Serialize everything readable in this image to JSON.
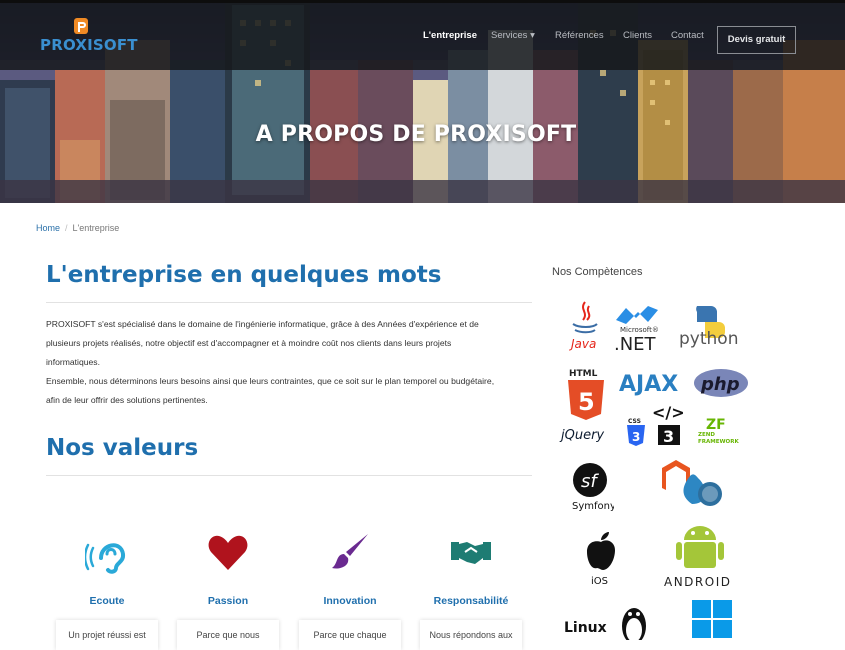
{
  "brand": {
    "name": "PROXISOFT"
  },
  "nav": {
    "items": [
      "L'entreprise",
      "Services ▾",
      "Références",
      "Clients",
      "Contact"
    ],
    "cta": "Devis gratuit"
  },
  "hero": {
    "title": "A PROPOS DE PROXISOFT"
  },
  "breadcrumb": {
    "home": "Home",
    "separator": "/",
    "current": "L'entreprise"
  },
  "about": {
    "title": "L'entreprise en quelques mots",
    "lines": [
      "PROXISOFT s'est spécialisé dans le domaine de l'ingénierie informatique, grâce à des Années d'expérience et de",
      "plusieurs projets réalisés, notre objectif est d'accompagner et à moindre coût nos clients dans leurs projets",
      "informatiques.",
      "Ensemble, nous déterminons leurs besoins ainsi que leurs contraintes, que ce soit sur le plan temporel ou budgétaire,",
      "afin de leur offrir des solutions pertinentes."
    ]
  },
  "values": {
    "title": "Nos valeurs",
    "items": [
      {
        "label": "Ecoute",
        "card": "Un projet réussi est",
        "icon": "ear-icon",
        "color": "#2aa9d8"
      },
      {
        "label": "Passion",
        "card": "Parce que nous",
        "icon": "heart-icon",
        "color": "#b0131d"
      },
      {
        "label": "Innovation",
        "card": "Parce que chaque",
        "icon": "paintbrush-icon",
        "color": "#6a2a90"
      },
      {
        "label": "Responsabilité",
        "card": "Nous répondons aux",
        "icon": "handshake-icon",
        "color": "#1e7c73"
      }
    ]
  },
  "sidebar": {
    "title": "Nos Compètences",
    "tech": {
      "java": "Java",
      "microsoft": "Microsoft®",
      "net": ".NET",
      "python": "python",
      "html": "HTML",
      "html5": "5",
      "ajax": "AJAX",
      "php": "php",
      "jquery": "jQuery",
      "css": "CSS",
      "css3": "3",
      "code": "</>",
      "js3": "3",
      "zend_zf": "ZF",
      "zend": "ZEND",
      "framework": "FRAMEWORK",
      "symfony_sf": "sf",
      "symfony": "Symfony",
      "ios": "iOS",
      "android": "ANDROID",
      "linux": "Linux"
    }
  },
  "colors": {
    "accent": "#1f6fad",
    "nav_bg": "#16181c",
    "link": "#2a70a9"
  }
}
